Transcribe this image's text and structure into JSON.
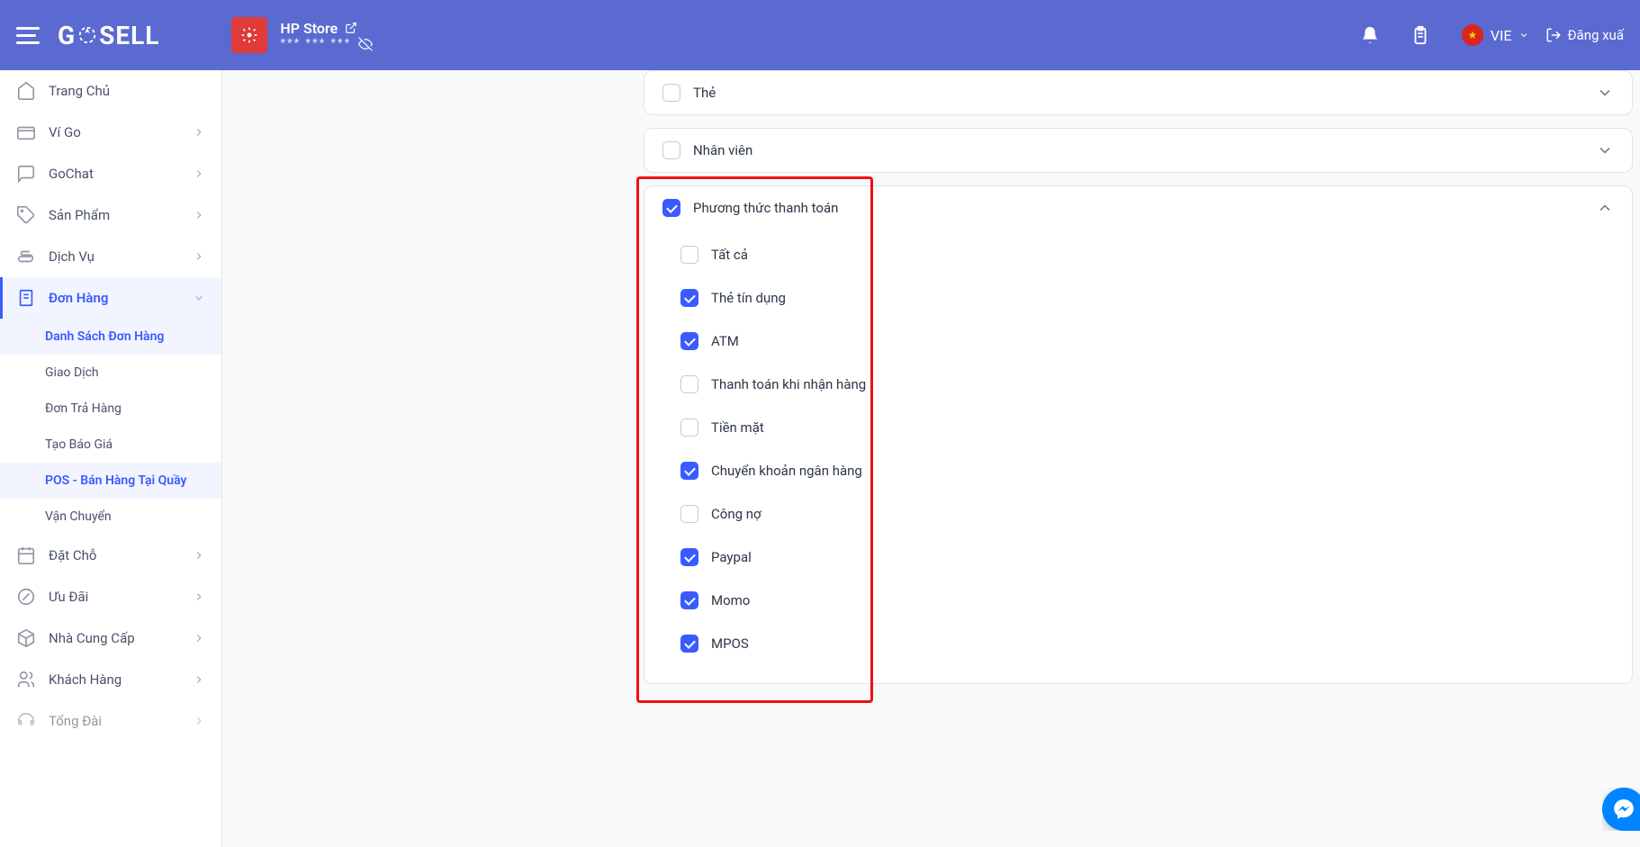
{
  "header": {
    "logo_text_1": "G",
    "logo_text_2": "SELL",
    "store_name": "HP Store",
    "store_stars": "***  ***  ***",
    "lang": "VIE",
    "logout": "Đăng xuấ"
  },
  "sidebar": {
    "items": [
      {
        "label": "Trang Chủ",
        "icon": "home",
        "expandable": false
      },
      {
        "label": "Ví Go",
        "icon": "wallet",
        "expandable": true
      },
      {
        "label": "GoChat",
        "icon": "chat",
        "expandable": true
      },
      {
        "label": "Sản Phẩm",
        "icon": "tag",
        "expandable": true
      },
      {
        "label": "Dịch Vụ",
        "icon": "hand",
        "expandable": true
      },
      {
        "label": "Đơn Hàng",
        "icon": "receipt",
        "expandable": true,
        "active": true
      },
      {
        "label": "Đặt Chỗ",
        "icon": "calendar",
        "expandable": true
      },
      {
        "label": "Ưu Đãi",
        "icon": "discount",
        "expandable": true
      },
      {
        "label": "Nhà Cung Cấp",
        "icon": "box",
        "expandable": true
      },
      {
        "label": "Khách Hàng",
        "icon": "users",
        "expandable": true
      },
      {
        "label": "Tổng Đài",
        "icon": "headset",
        "expandable": true
      }
    ],
    "order_sub": [
      {
        "label": "Danh Sách Đơn Hàng",
        "active": true
      },
      {
        "label": "Giao Dịch"
      },
      {
        "label": "Đơn Trả Hàng"
      },
      {
        "label": "Tạo Báo Giá"
      },
      {
        "label": "POS - Bán Hàng Tại Quầy",
        "active": true
      },
      {
        "label": "Vận Chuyển"
      }
    ]
  },
  "panels": {
    "the": {
      "label": "Thẻ",
      "checked": false
    },
    "nhanvien": {
      "label": "Nhân viên",
      "checked": false
    },
    "payment": {
      "label": "Phương thức thanh toán",
      "checked": true,
      "options": [
        {
          "label": "Tất cả",
          "checked": false
        },
        {
          "label": "Thẻ tín dụng",
          "checked": true
        },
        {
          "label": "ATM",
          "checked": true
        },
        {
          "label": "Thanh toán khi nhận hàng",
          "checked": false
        },
        {
          "label": "Tiền mặt",
          "checked": false
        },
        {
          "label": "Chuyển khoản ngân hàng",
          "checked": true
        },
        {
          "label": "Công nợ",
          "checked": false
        },
        {
          "label": "Paypal",
          "checked": true
        },
        {
          "label": "Momo",
          "checked": true
        },
        {
          "label": "MPOS",
          "checked": true
        }
      ]
    }
  }
}
